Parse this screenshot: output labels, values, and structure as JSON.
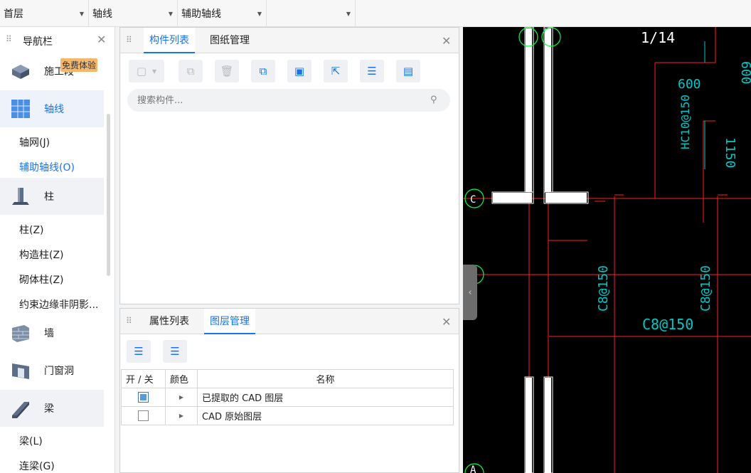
{
  "topbar": {
    "floor": "首层",
    "category": "轴线",
    "subcategory": "辅助轴线",
    "extra": ""
  },
  "nav": {
    "title": "导航栏",
    "badge": "免费体验",
    "categories": [
      {
        "label": "施工段"
      },
      {
        "label": "轴线"
      },
      {
        "label": "柱"
      },
      {
        "label": "墙"
      },
      {
        "label": "门窗洞"
      },
      {
        "label": "梁"
      }
    ],
    "axis_items": [
      "轴网(J)",
      "辅助轴线(O)"
    ],
    "column_items": [
      "柱(Z)",
      "构造柱(Z)",
      "砌体柱(Z)",
      "约束边缘非阴影..."
    ],
    "beam_items": [
      "梁(L)",
      "连梁(G)"
    ]
  },
  "component_panel": {
    "tabs": [
      "构件列表",
      "图纸管理"
    ],
    "search_placeholder": "搜索构件..."
  },
  "layer_panel": {
    "tabs": [
      "属性列表",
      "图层管理"
    ],
    "columns": [
      "开 / 关",
      "颜色",
      "名称"
    ],
    "rows": [
      {
        "checked": true,
        "name": "已提取的 CAD 图层"
      },
      {
        "checked": false,
        "name": "CAD 原始图层"
      }
    ]
  },
  "cad": {
    "scale": "1/14",
    "axis_c": "C",
    "axis_a": "A",
    "dim_600_top": "600",
    "dim_600": "600",
    "dim_1150": "1150",
    "rebar_10": "HC10@150",
    "rebar_8a": "C8@150",
    "rebar_8b": "C8@150",
    "rebar_8c": "C8@150",
    "colors": {
      "red": "#ff2020",
      "cyan": "#00c8c8",
      "green": "#00ff40",
      "white": "#ffffff",
      "bg": "#000000"
    }
  }
}
